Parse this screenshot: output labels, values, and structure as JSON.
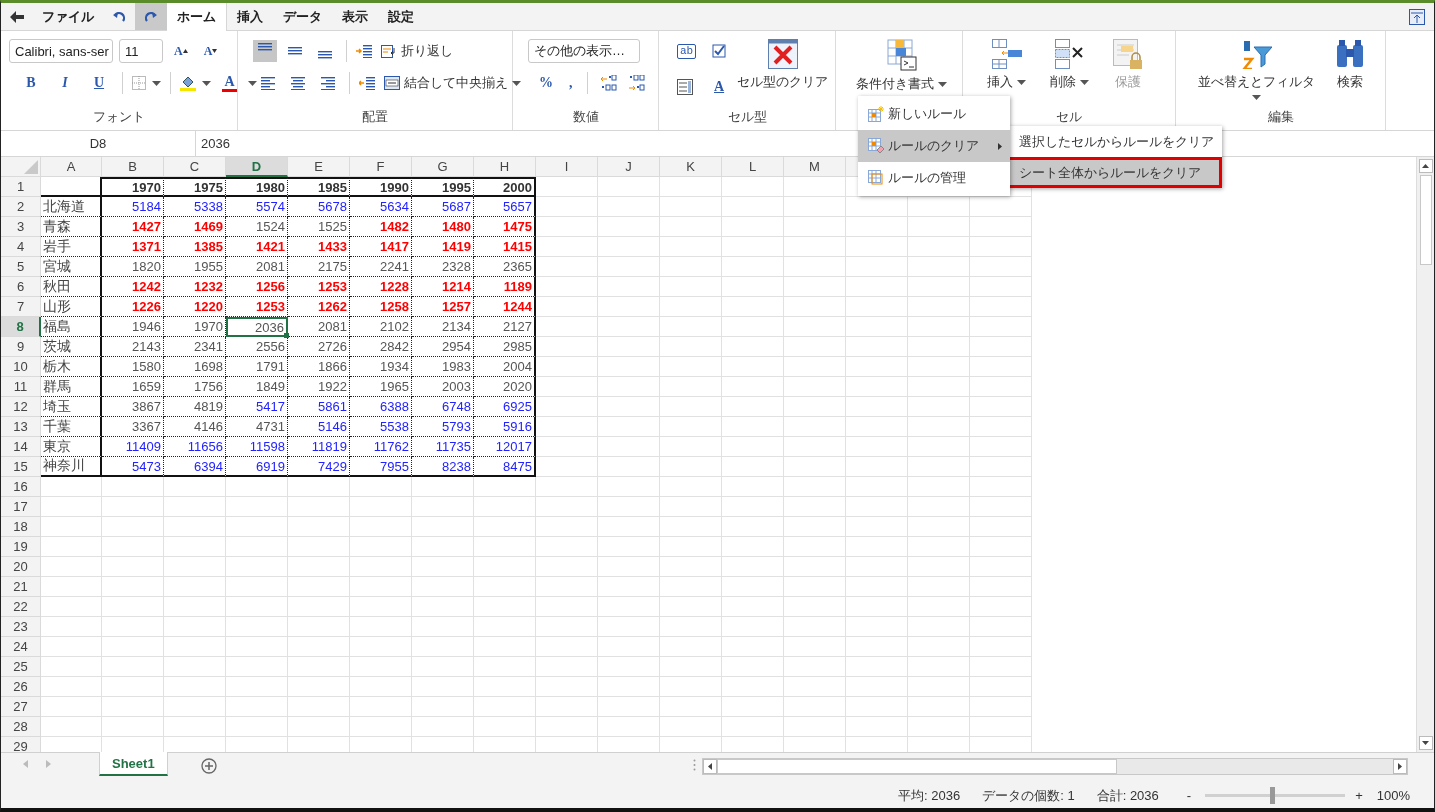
{
  "title_bar": {
    "file_menu": "ファイル",
    "history_buttons": [
      {
        "hovered": false
      },
      {
        "hovered": true
      }
    ],
    "tabs": [
      {
        "label": "ホーム",
        "selected": true
      },
      {
        "label": "挿入",
        "selected": false
      },
      {
        "label": "データ",
        "selected": false
      },
      {
        "label": "表示",
        "selected": false
      },
      {
        "label": "設定",
        "selected": false
      }
    ]
  },
  "ribbon": {
    "font": {
      "label": "フォント",
      "font_name": "Calibri, sans-ser",
      "font_size": "11",
      "grow_font": "A",
      "shrink_font": "A",
      "style_buttons": [
        "B",
        "I",
        "U"
      ],
      "font_color": "A"
    },
    "alignment": {
      "label": "配置",
      "vertical_align": [
        {
          "selected": true
        },
        {
          "selected": false
        },
        {
          "selected": false
        }
      ],
      "wrap": "折り返し",
      "merge": "結合して中央揃え"
    },
    "number": {
      "label": "数値",
      "format": "その他の表示…",
      "percent": "%",
      "comma": ","
    },
    "cell_type": {
      "label": "セル型",
      "textbox": "ab",
      "text_style": "A",
      "clear": "セル型のクリア"
    },
    "styles": {
      "conditional_format": "条件付き書式"
    },
    "cells": {
      "label": "セル",
      "buttons": [
        {
          "label": "挿入",
          "dropdown": true,
          "disabled": false
        },
        {
          "label": "削除",
          "dropdown": true,
          "disabled": false
        },
        {
          "label": "保護",
          "dropdown": false,
          "disabled": true
        }
      ]
    },
    "editing": {
      "label": "編集",
      "buttons": [
        {
          "label": "並べ替えとフィルタ",
          "dropdown": true
        },
        {
          "label": "検索",
          "dropdown": false
        }
      ]
    }
  },
  "formula_bar": {
    "cell": "D8",
    "value": "2036"
  },
  "sheet": {
    "columns": [
      {
        "label": "A",
        "selected": false
      },
      {
        "label": "B",
        "selected": false
      },
      {
        "label": "C",
        "selected": false
      },
      {
        "label": "D",
        "selected": true
      },
      {
        "label": "E",
        "selected": false
      },
      {
        "label": "F",
        "selected": false
      },
      {
        "label": "G",
        "selected": false
      },
      {
        "label": "H",
        "selected": false
      },
      {
        "label": "I",
        "selected": false
      },
      {
        "label": "J",
        "selected": false
      },
      {
        "label": "K",
        "selected": false
      },
      {
        "label": "L",
        "selected": false
      },
      {
        "label": "M",
        "selected": false
      }
    ],
    "rows": [
      {
        "label": "1",
        "selected": false,
        "cells": [
          {
            "text": "1970",
            "kind": "header",
            "selected": false
          },
          {
            "text": "1975",
            "kind": "header",
            "selected": false
          },
          {
            "text": "1980",
            "kind": "header",
            "selected": false
          },
          {
            "text": "1985",
            "kind": "header",
            "selected": false
          },
          {
            "text": "1990",
            "kind": "header",
            "selected": false
          },
          {
            "text": "1995",
            "kind": "header",
            "selected": false
          },
          {
            "text": "2000",
            "kind": "header",
            "selected": false
          }
        ]
      },
      {
        "label": "2",
        "selected": false,
        "name": "北海道",
        "cells": [
          {
            "text": "5184",
            "kind": "high",
            "selected": false
          },
          {
            "text": "5338",
            "kind": "high",
            "selected": false
          },
          {
            "text": "5574",
            "kind": "high",
            "selected": false
          },
          {
            "text": "5678",
            "kind": "high",
            "selected": false
          },
          {
            "text": "5634",
            "kind": "high",
            "selected": false
          },
          {
            "text": "5687",
            "kind": "high",
            "selected": false
          },
          {
            "text": "5657",
            "kind": "high",
            "selected": false
          }
        ]
      },
      {
        "label": "3",
        "selected": false,
        "name": "青森",
        "cells": [
          {
            "text": "1427",
            "kind": "low",
            "selected": false
          },
          {
            "text": "1469",
            "kind": "low",
            "selected": false
          },
          {
            "text": "1524",
            "kind": "plain",
            "selected": false
          },
          {
            "text": "1525",
            "kind": "plain",
            "selected": false
          },
          {
            "text": "1482",
            "kind": "low",
            "selected": false
          },
          {
            "text": "1480",
            "kind": "low",
            "selected": false
          },
          {
            "text": "1475",
            "kind": "low",
            "selected": false
          }
        ]
      },
      {
        "label": "4",
        "selected": false,
        "name": "岩手",
        "cells": [
          {
            "text": "1371",
            "kind": "low",
            "selected": false
          },
          {
            "text": "1385",
            "kind": "low",
            "selected": false
          },
          {
            "text": "1421",
            "kind": "low",
            "selected": false
          },
          {
            "text": "1433",
            "kind": "low",
            "selected": false
          },
          {
            "text": "1417",
            "kind": "low",
            "selected": false
          },
          {
            "text": "1419",
            "kind": "low",
            "selected": false
          },
          {
            "text": "1415",
            "kind": "low",
            "selected": false
          }
        ]
      },
      {
        "label": "5",
        "selected": false,
        "name": "宮城",
        "cells": [
          {
            "text": "1820",
            "kind": "plain",
            "selected": false
          },
          {
            "text": "1955",
            "kind": "plain",
            "selected": false
          },
          {
            "text": "2081",
            "kind": "plain",
            "selected": false
          },
          {
            "text": "2175",
            "kind": "plain",
            "selected": false
          },
          {
            "text": "2241",
            "kind": "plain",
            "selected": false
          },
          {
            "text": "2328",
            "kind": "plain",
            "selected": false
          },
          {
            "text": "2365",
            "kind": "plain",
            "selected": false
          }
        ]
      },
      {
        "label": "6",
        "selected": false,
        "name": "秋田",
        "cells": [
          {
            "text": "1242",
            "kind": "low",
            "selected": false
          },
          {
            "text": "1232",
            "kind": "low",
            "selected": false
          },
          {
            "text": "1256",
            "kind": "low",
            "selected": false
          },
          {
            "text": "1253",
            "kind": "low",
            "selected": false
          },
          {
            "text": "1228",
            "kind": "low",
            "selected": false
          },
          {
            "text": "1214",
            "kind": "low",
            "selected": false
          },
          {
            "text": "1189",
            "kind": "low",
            "selected": false
          }
        ]
      },
      {
        "label": "7",
        "selected": false,
        "name": "山形",
        "cells": [
          {
            "text": "1226",
            "kind": "low",
            "selected": false
          },
          {
            "text": "1220",
            "kind": "low",
            "selected": false
          },
          {
            "text": "1253",
            "kind": "low",
            "selected": false
          },
          {
            "text": "1262",
            "kind": "low",
            "selected": false
          },
          {
            "text": "1258",
            "kind": "low",
            "selected": false
          },
          {
            "text": "1257",
            "kind": "low",
            "selected": false
          },
          {
            "text": "1244",
            "kind": "low",
            "selected": false
          }
        ]
      },
      {
        "label": "8",
        "selected": true,
        "name": "福島",
        "cells": [
          {
            "text": "1946",
            "kind": "plain",
            "selected": false
          },
          {
            "text": "1970",
            "kind": "plain",
            "selected": false
          },
          {
            "text": "2036",
            "kind": "plain",
            "selected": true
          },
          {
            "text": "2081",
            "kind": "plain",
            "selected": false
          },
          {
            "text": "2102",
            "kind": "plain",
            "selected": false
          },
          {
            "text": "2134",
            "kind": "plain",
            "selected": false
          },
          {
            "text": "2127",
            "kind": "plain",
            "selected": false
          }
        ]
      },
      {
        "label": "9",
        "selected": false,
        "name": "茨城",
        "cells": [
          {
            "text": "2143",
            "kind": "plain",
            "selected": false
          },
          {
            "text": "2341",
            "kind": "plain",
            "selected": false
          },
          {
            "text": "2556",
            "kind": "plain",
            "selected": false
          },
          {
            "text": "2726",
            "kind": "plain",
            "selected": false
          },
          {
            "text": "2842",
            "kind": "plain",
            "selected": false
          },
          {
            "text": "2954",
            "kind": "plain",
            "selected": false
          },
          {
            "text": "2985",
            "kind": "plain",
            "selected": false
          }
        ]
      },
      {
        "label": "10",
        "selected": false,
        "name": "栃木",
        "cells": [
          {
            "text": "1580",
            "kind": "plain",
            "selected": false
          },
          {
            "text": "1698",
            "kind": "plain",
            "selected": false
          },
          {
            "text": "1791",
            "kind": "plain",
            "selected": false
          },
          {
            "text": "1866",
            "kind": "plain",
            "selected": false
          },
          {
            "text": "1934",
            "kind": "plain",
            "selected": false
          },
          {
            "text": "1983",
            "kind": "plain",
            "selected": false
          },
          {
            "text": "2004",
            "kind": "plain",
            "selected": false
          }
        ]
      },
      {
        "label": "11",
        "selected": false,
        "name": "群馬",
        "cells": [
          {
            "text": "1659",
            "kind": "plain",
            "selected": false
          },
          {
            "text": "1756",
            "kind": "plain",
            "selected": false
          },
          {
            "text": "1849",
            "kind": "plain",
            "selected": false
          },
          {
            "text": "1922",
            "kind": "plain",
            "selected": false
          },
          {
            "text": "1965",
            "kind": "plain",
            "selected": false
          },
          {
            "text": "2003",
            "kind": "plain",
            "selected": false
          },
          {
            "text": "2020",
            "kind": "plain",
            "selected": false
          }
        ]
      },
      {
        "label": "12",
        "selected": false,
        "name": "埼玉",
        "cells": [
          {
            "text": "3867",
            "kind": "plain",
            "selected": false
          },
          {
            "text": "4819",
            "kind": "plain",
            "selected": false
          },
          {
            "text": "5417",
            "kind": "high",
            "selected": false
          },
          {
            "text": "5861",
            "kind": "high",
            "selected": false
          },
          {
            "text": "6388",
            "kind": "high",
            "selected": false
          },
          {
            "text": "6748",
            "kind": "high",
            "selected": false
          },
          {
            "text": "6925",
            "kind": "high",
            "selected": false
          }
        ]
      },
      {
        "label": "13",
        "selected": false,
        "name": "千葉",
        "cells": [
          {
            "text": "3367",
            "kind": "plain",
            "selected": false
          },
          {
            "text": "4146",
            "kind": "plain",
            "selected": false
          },
          {
            "text": "4731",
            "kind": "plain",
            "selected": false
          },
          {
            "text": "5146",
            "kind": "high",
            "selected": false
          },
          {
            "text": "5538",
            "kind": "high",
            "selected": false
          },
          {
            "text": "5793",
            "kind": "high",
            "selected": false
          },
          {
            "text": "5916",
            "kind": "high",
            "selected": false
          }
        ]
      },
      {
        "label": "14",
        "selected": false,
        "name": "東京",
        "cells": [
          {
            "text": "11409",
            "kind": "high",
            "selected": false
          },
          {
            "text": "11656",
            "kind": "high",
            "selected": false
          },
          {
            "text": "11598",
            "kind": "high",
            "selected": false
          },
          {
            "text": "11819",
            "kind": "high",
            "selected": false
          },
          {
            "text": "11762",
            "kind": "high",
            "selected": false
          },
          {
            "text": "11735",
            "kind": "high",
            "selected": false
          },
          {
            "text": "12017",
            "kind": "high",
            "selected": false
          }
        ]
      },
      {
        "label": "15",
        "selected": false,
        "name": "神奈川",
        "cells": [
          {
            "text": "5473",
            "kind": "high",
            "selected": false
          },
          {
            "text": "6394",
            "kind": "high",
            "selected": false
          },
          {
            "text": "6919",
            "kind": "high",
            "selected": false
          },
          {
            "text": "7429",
            "kind": "high",
            "selected": false
          },
          {
            "text": "7955",
            "kind": "high",
            "selected": false
          },
          {
            "text": "8238",
            "kind": "high",
            "selected": false
          },
          {
            "text": "8475",
            "kind": "high",
            "selected": false
          }
        ]
      },
      {
        "label": "16",
        "selected": false
      },
      {
        "label": "17",
        "selected": false
      },
      {
        "label": "18",
        "selected": false
      },
      {
        "label": "19",
        "selected": false
      },
      {
        "label": "20",
        "selected": false
      },
      {
        "label": "21",
        "selected": false
      },
      {
        "label": "22",
        "selected": false
      },
      {
        "label": "23",
        "selected": false
      },
      {
        "label": "24",
        "selected": false
      },
      {
        "label": "25",
        "selected": false
      },
      {
        "label": "26",
        "selected": false
      },
      {
        "label": "27",
        "selected": false
      },
      {
        "label": "28",
        "selected": false
      },
      {
        "label": "29",
        "selected": false
      }
    ]
  },
  "context_menu": {
    "items": [
      {
        "label": "新しいルール",
        "selected": false
      },
      {
        "label": "ルールのクリア",
        "selected": true,
        "submenu": [
          {
            "label": "選択したセルからルールをクリア",
            "selected": false,
            "highlighted": false
          },
          {
            "label": "シート全体からルールをクリア",
            "selected": true,
            "highlighted": true
          }
        ]
      },
      {
        "label": "ルールの管理",
        "selected": false
      }
    ]
  },
  "sheet_tabs": [
    {
      "label": "Sheet1",
      "selected": true
    }
  ],
  "status_bar": {
    "stats": [
      "平均: 2036",
      "データの個数: 1",
      "合計: 2036"
    ],
    "zoom": {
      "minus": "-",
      "level": 0.48,
      "plus": "+",
      "reading": "100%"
    }
  }
}
